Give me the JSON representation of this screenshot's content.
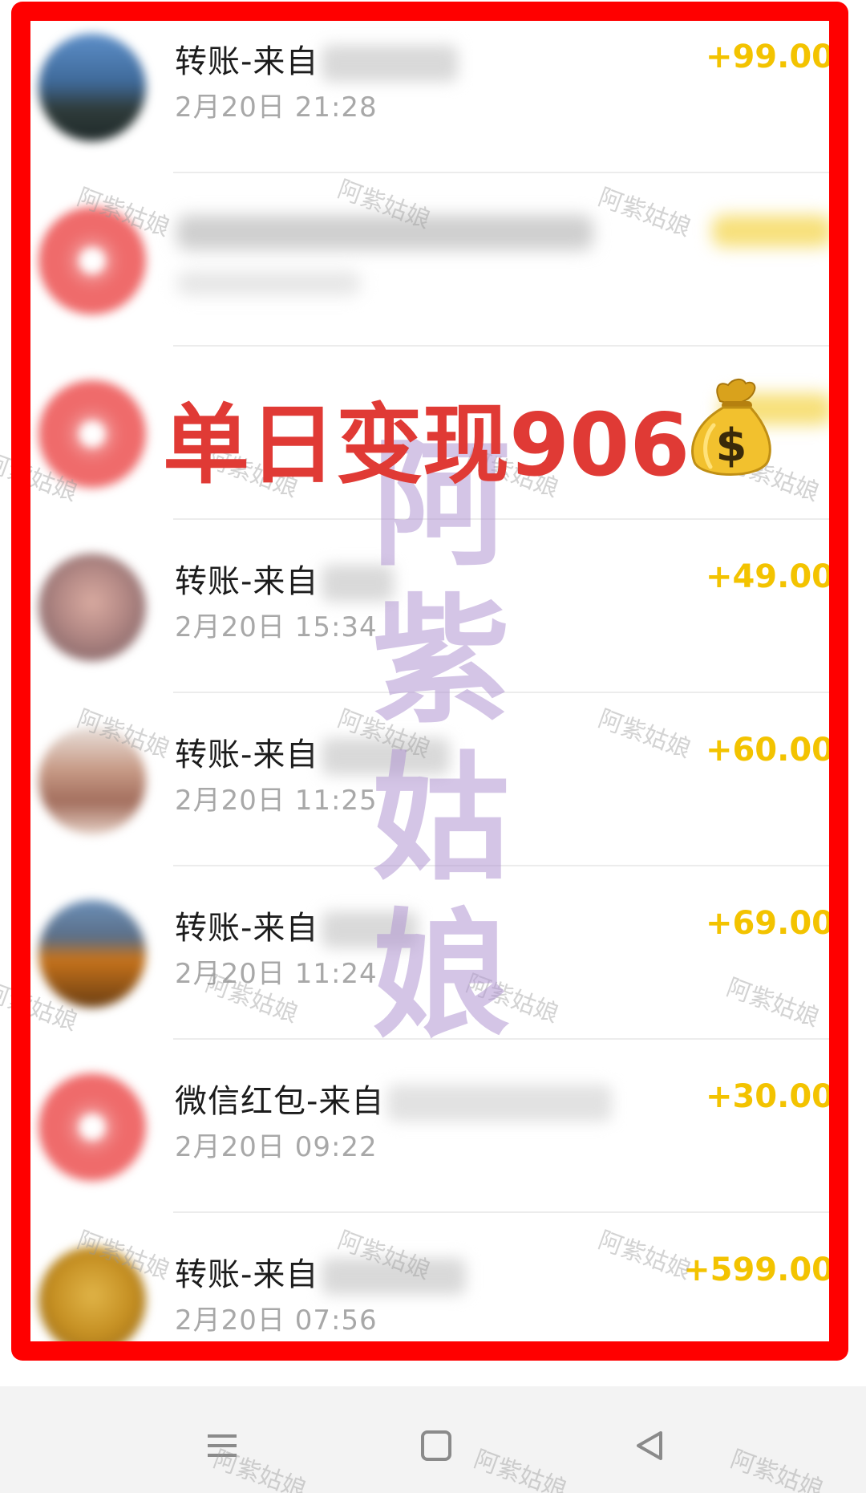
{
  "headline": {
    "text": "单日变现906",
    "icon": "money-bag-icon"
  },
  "watermark": {
    "small": "阿紫姑娘",
    "big_chars": [
      "阿",
      "紫",
      "姑",
      "娘"
    ]
  },
  "transactions": [
    {
      "title": "转账-来自",
      "date": "2月20日 21:28",
      "amount": "+99.00",
      "avatar": "landscape"
    },
    {
      "title": "",
      "date": "",
      "amount": "",
      "avatar": "red",
      "blurred": true
    },
    {
      "title": "",
      "date": "",
      "amount": "",
      "avatar": "red",
      "blurred": true
    },
    {
      "title": "转账-来自",
      "date": "2月20日 15:34",
      "amount": "+49.00",
      "avatar": "face"
    },
    {
      "title": "转账-来自",
      "date": "2月20日 11:25",
      "amount": "+60.00",
      "avatar": "cake"
    },
    {
      "title": "转账-来自",
      "date": "2月20日 11:24",
      "amount": "+69.00",
      "avatar": "orange"
    },
    {
      "title": "微信红包-来自",
      "date": "2月20日 09:22",
      "amount": "+30.00",
      "avatar": "red"
    },
    {
      "title": "转账-来自",
      "date": "2月20日 07:56",
      "amount": "+599.00",
      "avatar": "gold"
    }
  ],
  "navbar": {
    "items": [
      "menu-icon",
      "home-square-icon",
      "back-triangle-icon"
    ]
  },
  "colors": {
    "frame": "#ff0000",
    "amount": "#f3c300",
    "headline": "#e03a35"
  }
}
